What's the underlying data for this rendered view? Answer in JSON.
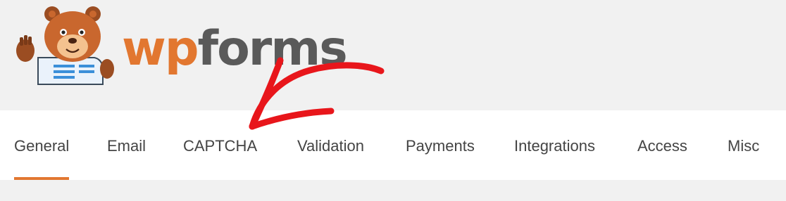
{
  "brand": {
    "wp": "wp",
    "forms": "forms",
    "accent_color": "#e27730",
    "text_color": "#5a5a5a"
  },
  "tabs": [
    {
      "label": "General",
      "active": true
    },
    {
      "label": "Email",
      "active": false
    },
    {
      "label": "CAPTCHA",
      "active": false
    },
    {
      "label": "Validation",
      "active": false
    },
    {
      "label": "Payments",
      "active": false
    },
    {
      "label": "Integrations",
      "active": false
    },
    {
      "label": "Access",
      "active": false
    },
    {
      "label": "Misc",
      "active": false
    }
  ],
  "annotation": {
    "type": "arrow",
    "color": "#e8161b",
    "points_to": "CAPTCHA"
  }
}
